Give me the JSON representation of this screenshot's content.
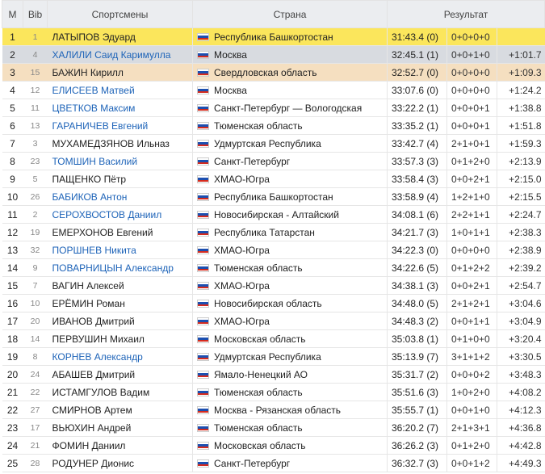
{
  "header": {
    "pos": "М",
    "bib": "Bib",
    "athletes": "Спортсмены",
    "country": "Страна",
    "result": "Результат"
  },
  "rows": [
    {
      "pos": "1",
      "bib": "1",
      "name": "ЛАТЫПОВ Эдуард",
      "link": false,
      "region": "Республика Башкортостан",
      "time": "31:43.4 (0)",
      "pen": "0+0+0+0",
      "gap": "",
      "medal": "gold"
    },
    {
      "pos": "2",
      "bib": "4",
      "name": "ХАЛИЛИ Саид Каримулла",
      "link": true,
      "region": "Москва",
      "time": "32:45.1 (1)",
      "pen": "0+0+1+0",
      "gap": "+1:01.7",
      "medal": "silver"
    },
    {
      "pos": "3",
      "bib": "15",
      "name": "БАЖИН Кирилл",
      "link": false,
      "region": "Свердловская область",
      "time": "32:52.7 (0)",
      "pen": "0+0+0+0",
      "gap": "+1:09.3",
      "medal": "bronze"
    },
    {
      "pos": "4",
      "bib": "12",
      "name": "ЕЛИСЕЕВ Матвей",
      "link": true,
      "region": "Москва",
      "time": "33:07.6 (0)",
      "pen": "0+0+0+0",
      "gap": "+1:24.2",
      "medal": ""
    },
    {
      "pos": "5",
      "bib": "11",
      "name": "ЦВЕТКОВ Максим",
      "link": true,
      "region": "Санкт-Петербург — Вологодская",
      "time": "33:22.2 (1)",
      "pen": "0+0+0+1",
      "gap": "+1:38.8",
      "medal": ""
    },
    {
      "pos": "6",
      "bib": "13",
      "name": "ГАРАНИЧЕВ Евгений",
      "link": true,
      "region": "Тюменская область",
      "time": "33:35.2 (1)",
      "pen": "0+0+0+1",
      "gap": "+1:51.8",
      "medal": ""
    },
    {
      "pos": "7",
      "bib": "3",
      "name": "МУХАМЕДЗЯНОВ Ильназ",
      "link": false,
      "region": "Удмуртская Республика",
      "time": "33:42.7 (4)",
      "pen": "2+1+0+1",
      "gap": "+1:59.3",
      "medal": ""
    },
    {
      "pos": "8",
      "bib": "23",
      "name": "ТОМШИН Василий",
      "link": true,
      "region": "Санкт-Петербург",
      "time": "33:57.3 (3)",
      "pen": "0+1+2+0",
      "gap": "+2:13.9",
      "medal": ""
    },
    {
      "pos": "9",
      "bib": "5",
      "name": "ПАЩЕНКО Пётр",
      "link": false,
      "region": "ХМАО-Югра",
      "time": "33:58.4 (3)",
      "pen": "0+0+2+1",
      "gap": "+2:15.0",
      "medal": ""
    },
    {
      "pos": "10",
      "bib": "26",
      "name": "БАБИКОВ Антон",
      "link": true,
      "region": "Республика Башкортостан",
      "time": "33:58.9 (4)",
      "pen": "1+2+1+0",
      "gap": "+2:15.5",
      "medal": ""
    },
    {
      "pos": "11",
      "bib": "2",
      "name": "СЕРОХВОСТОВ Даниил",
      "link": true,
      "region": "Новосибирская - Алтайский",
      "time": "34:08.1 (6)",
      "pen": "2+2+1+1",
      "gap": "+2:24.7",
      "medal": ""
    },
    {
      "pos": "12",
      "bib": "19",
      "name": "ЕМЕРХОНОВ Евгений",
      "link": false,
      "region": "Республика Татарстан",
      "time": "34:21.7 (3)",
      "pen": "1+0+1+1",
      "gap": "+2:38.3",
      "medal": ""
    },
    {
      "pos": "13",
      "bib": "32",
      "name": "ПОРШНЕВ Никита",
      "link": true,
      "region": "ХМАО-Югра",
      "time": "34:22.3 (0)",
      "pen": "0+0+0+0",
      "gap": "+2:38.9",
      "medal": ""
    },
    {
      "pos": "14",
      "bib": "9",
      "name": "ПОВАРНИЦЫН Александр",
      "link": true,
      "region": "Тюменская область",
      "time": "34:22.6 (5)",
      "pen": "0+1+2+2",
      "gap": "+2:39.2",
      "medal": ""
    },
    {
      "pos": "15",
      "bib": "7",
      "name": "ВАГИН Алексей",
      "link": false,
      "region": "ХМАО-Югра",
      "time": "34:38.1 (3)",
      "pen": "0+0+2+1",
      "gap": "+2:54.7",
      "medal": ""
    },
    {
      "pos": "16",
      "bib": "10",
      "name": "ЕРЁМИН Роман",
      "link": false,
      "region": "Новосибирская область",
      "time": "34:48.0 (5)",
      "pen": "2+1+2+1",
      "gap": "+3:04.6",
      "medal": ""
    },
    {
      "pos": "17",
      "bib": "20",
      "name": "ИВАНОВ Дмитрий",
      "link": false,
      "region": "ХМАО-Югра",
      "time": "34:48.3 (2)",
      "pen": "0+0+1+1",
      "gap": "+3:04.9",
      "medal": ""
    },
    {
      "pos": "18",
      "bib": "14",
      "name": "ПЕРВУШИН Михаил",
      "link": false,
      "region": "Московская область",
      "time": "35:03.8 (1)",
      "pen": "0+1+0+0",
      "gap": "+3:20.4",
      "medal": ""
    },
    {
      "pos": "19",
      "bib": "8",
      "name": "КОРНЕВ Александр",
      "link": true,
      "region": "Удмуртская Республика",
      "time": "35:13.9 (7)",
      "pen": "3+1+1+2",
      "gap": "+3:30.5",
      "medal": ""
    },
    {
      "pos": "20",
      "bib": "24",
      "name": "АБАШЕВ Дмитрий",
      "link": false,
      "region": "Ямало-Ненецкий АО",
      "time": "35:31.7 (2)",
      "pen": "0+0+0+2",
      "gap": "+3:48.3",
      "medal": ""
    },
    {
      "pos": "21",
      "bib": "22",
      "name": "ИСТАМГУЛОВ Вадим",
      "link": false,
      "region": "Тюменская область",
      "time": "35:51.6 (3)",
      "pen": "1+0+2+0",
      "gap": "+4:08.2",
      "medal": ""
    },
    {
      "pos": "22",
      "bib": "27",
      "name": "СМИРНОВ Артем",
      "link": false,
      "region": "Москва - Рязанская область",
      "time": "35:55.7 (1)",
      "pen": "0+0+1+0",
      "gap": "+4:12.3",
      "medal": ""
    },
    {
      "pos": "23",
      "bib": "17",
      "name": "ВЬЮХИН Андрей",
      "link": false,
      "region": "Тюменская область",
      "time": "36:20.2 (7)",
      "pen": "2+1+3+1",
      "gap": "+4:36.8",
      "medal": ""
    },
    {
      "pos": "24",
      "bib": "21",
      "name": "ФОМИН Даниил",
      "link": false,
      "region": "Московская область",
      "time": "36:26.2 (3)",
      "pen": "0+1+2+0",
      "gap": "+4:42.8",
      "medal": ""
    },
    {
      "pos": "25",
      "bib": "28",
      "name": "РОДУНЕР Дионис",
      "link": false,
      "region": "Санкт-Петербург",
      "time": "36:32.7 (3)",
      "pen": "0+0+1+2",
      "gap": "+4:49.3",
      "medal": ""
    }
  ]
}
